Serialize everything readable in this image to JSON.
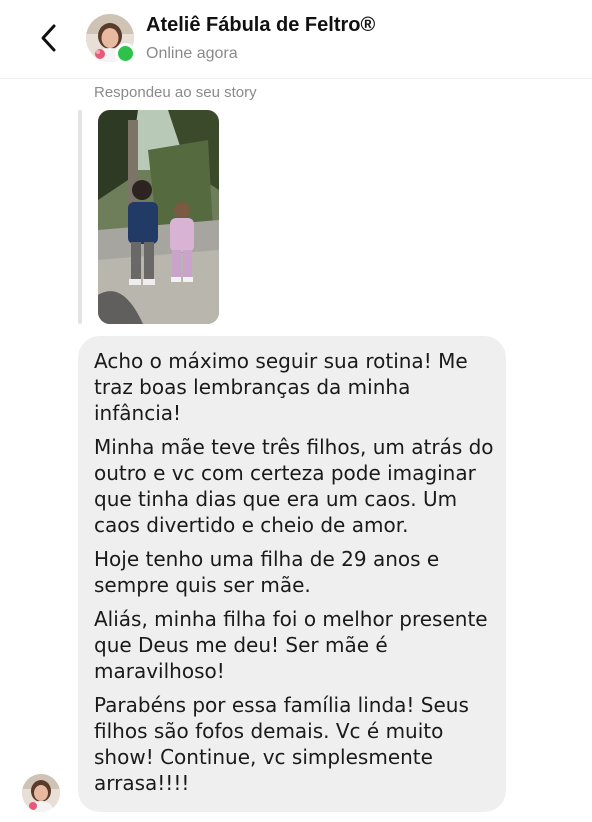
{
  "header": {
    "name": "Ateliê Fábula de Feltro®",
    "status": "Online agora",
    "online_color": "#2ec24a",
    "back_icon": "chevron-left-icon"
  },
  "story_reply": {
    "label": "Respondeu ao seu story"
  },
  "message": {
    "lines": [
      "Acho o máximo seguir sua rotina! Me",
      "traz boas lembranças da minha",
      "infância!",
      "Minha mãe teve três filhos, um atrás do",
      "outro e vc com certeza pode imaginar",
      "que tinha dias que era um caos. Um",
      "caos divertido e cheio de amor.",
      "Hoje tenho uma filha de 29 anos e",
      "sempre quis ser mãe.",
      "Aliás, minha filha foi o melhor presente",
      "que Deus me deu! Ser mãe é",
      "maravilhoso!",
      "Parabéns por essa família linda! Seus",
      "filhos são fofos demais. Vc é muito",
      "show! Continue, vc simplesmente",
      "arrasa!!!!"
    ],
    "bubble_color": "#efefef"
  }
}
